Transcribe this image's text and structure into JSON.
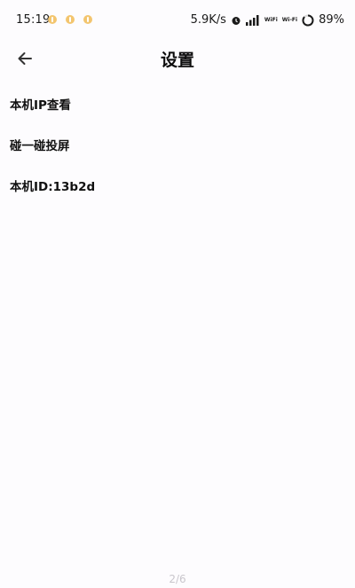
{
  "status_bar": {
    "time": "15:19",
    "net_speed": "5.9K/s",
    "wifi_tag_1": "WiFi",
    "wifi_tag_2": "Wi-Fi",
    "battery": "89%",
    "notification_color": "#f3c56f"
  },
  "app_bar": {
    "title": "设置",
    "back_icon": "arrow-left-icon"
  },
  "settings": {
    "items": [
      {
        "label": "本机IP查看"
      },
      {
        "label": "碰一碰投屏"
      },
      {
        "label": "本机ID:13b2d"
      }
    ]
  },
  "page_indicator": "2/6"
}
